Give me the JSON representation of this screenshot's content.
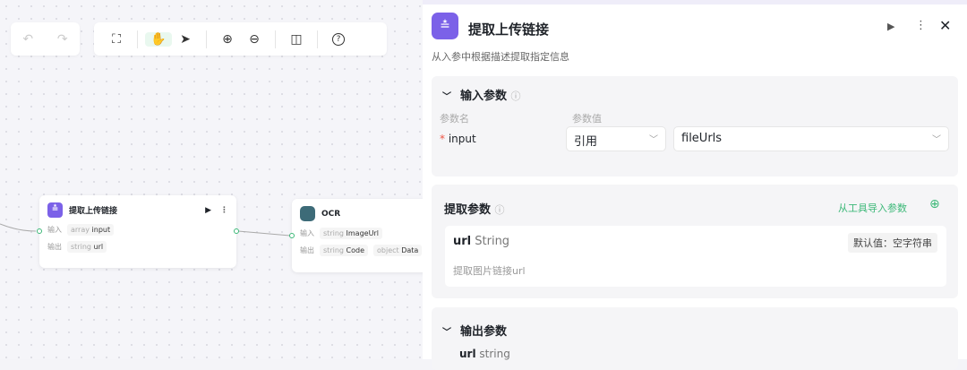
{
  "toolbar": {
    "undo": "↶",
    "redo": "↷",
    "fit": "⛶",
    "hand": "✋",
    "pointer": "➤",
    "zoom_in": "⊕",
    "zoom_out": "⊖",
    "layout": "◫",
    "help": "?"
  },
  "nodes": [
    {
      "title": "提取上传链接",
      "in_label": "输入",
      "in_type": "array",
      "in_name": "input",
      "out_label": "输出",
      "out_type": "string",
      "out_name": "url"
    },
    {
      "title": "OCR",
      "in_label": "输入",
      "in_type": "string",
      "in_name": "ImageUrl",
      "out_label": "输出",
      "out_type": "string",
      "out_name": "Code",
      "out2_type": "object",
      "out2_name": "Data"
    }
  ],
  "panel": {
    "title": "提取上传链接",
    "description": "从入参中根据描述提取指定信息",
    "input_section": {
      "title": "输入参数",
      "col_name": "参数名",
      "col_value": "参数值",
      "param": "input",
      "required": "*",
      "mode": "引用",
      "value": "fileUrls"
    },
    "extract_section": {
      "title": "提取参数",
      "import_link": "从工具导入参数",
      "field_name": "url",
      "field_type": "String",
      "default": "默认值：空字符串",
      "field_desc": "提取图片链接url"
    },
    "output_section": {
      "title": "输出参数",
      "field_name": "url",
      "field_type": "string"
    }
  },
  "colors": {
    "accent": "#7b61e8",
    "green": "#3cb878"
  }
}
